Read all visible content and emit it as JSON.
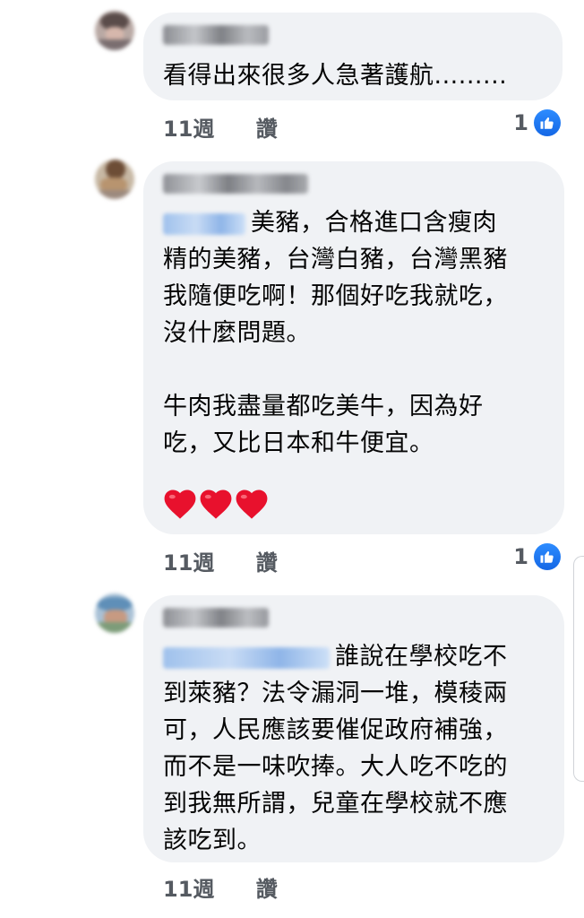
{
  "comments": [
    {
      "text": "看得出來很多人急著護航.........",
      "time": "11週",
      "like_label": "讚",
      "reactions": "1"
    },
    {
      "text": "美豬，合格進口含瘦肉\n精的美豬，台灣白豬，台灣黑豬\n我隨便吃啊！那個好吃我就吃，\n沒什麼問題。\n\n牛肉我盡量都吃美牛，因為好\n吃，又比日本和牛便宜。",
      "emoji": "❤❤❤",
      "time": "11週",
      "like_label": "讚",
      "reactions": "1"
    },
    {
      "text": "誰說在學校吃不\n到萊豬？法令漏洞一堆，模稜兩\n可，人民應該要催促政府補強，\n而不是一味吹捧。大人吃不吃的\n到我無所謂，兒童在學校就不應\n該吃到。",
      "time": "11週",
      "like_label": "讚"
    }
  ],
  "icons": {
    "reaction": "like-thumb-icon",
    "emoji": "heart-icon"
  },
  "colors": {
    "bubble": "#f0f2f5",
    "meta_text": "#555a61",
    "like_blue": "#1877f2",
    "heart": "#e8112d"
  }
}
